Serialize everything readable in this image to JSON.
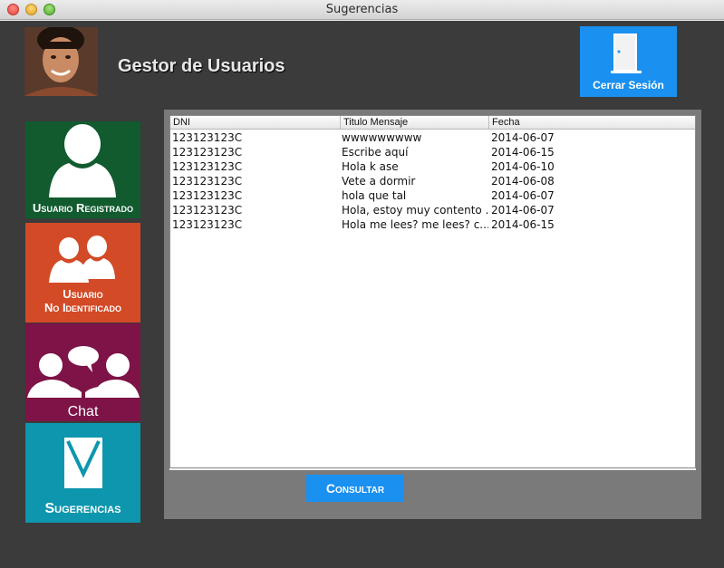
{
  "window": {
    "title": "Sugerencias"
  },
  "header": {
    "app_title": "Gestor de Usuarios",
    "logout_label": "Cerrar Sesión"
  },
  "sidebar": {
    "items": [
      {
        "label": "Usuario Registrado",
        "color": "#115b2f"
      },
      {
        "label_line1": "Usuario",
        "label_line2": "No Identificado",
        "color": "#d34a27"
      },
      {
        "label": "Chat",
        "color": "#7d1346"
      },
      {
        "label": "Sugerencias",
        "color": "#0d96ad"
      }
    ]
  },
  "table": {
    "columns": [
      "DNI",
      "Titulo Mensaje",
      "Fecha"
    ],
    "rows": [
      [
        "123123123C",
        "wwwwwwwww",
        "2014-06-07"
      ],
      [
        "123123123C",
        "Escribe aquí",
        "2014-06-15"
      ],
      [
        "123123123C",
        "Hola k ase",
        "2014-06-10"
      ],
      [
        "123123123C",
        "Vete a dormir",
        "2014-06-08"
      ],
      [
        "123123123C",
        "hola que tal",
        "2014-06-07"
      ],
      [
        "123123123C",
        "Hola, estoy muy contento ...",
        "2014-06-07"
      ],
      [
        "123123123C",
        "Hola me lees? me lees? c...",
        "2014-06-15"
      ]
    ]
  },
  "actions": {
    "consultar_label": "Consultar"
  },
  "colors": {
    "accent": "#1a90f0",
    "background": "#3b3b3b",
    "panel": "#7a7a7a"
  }
}
